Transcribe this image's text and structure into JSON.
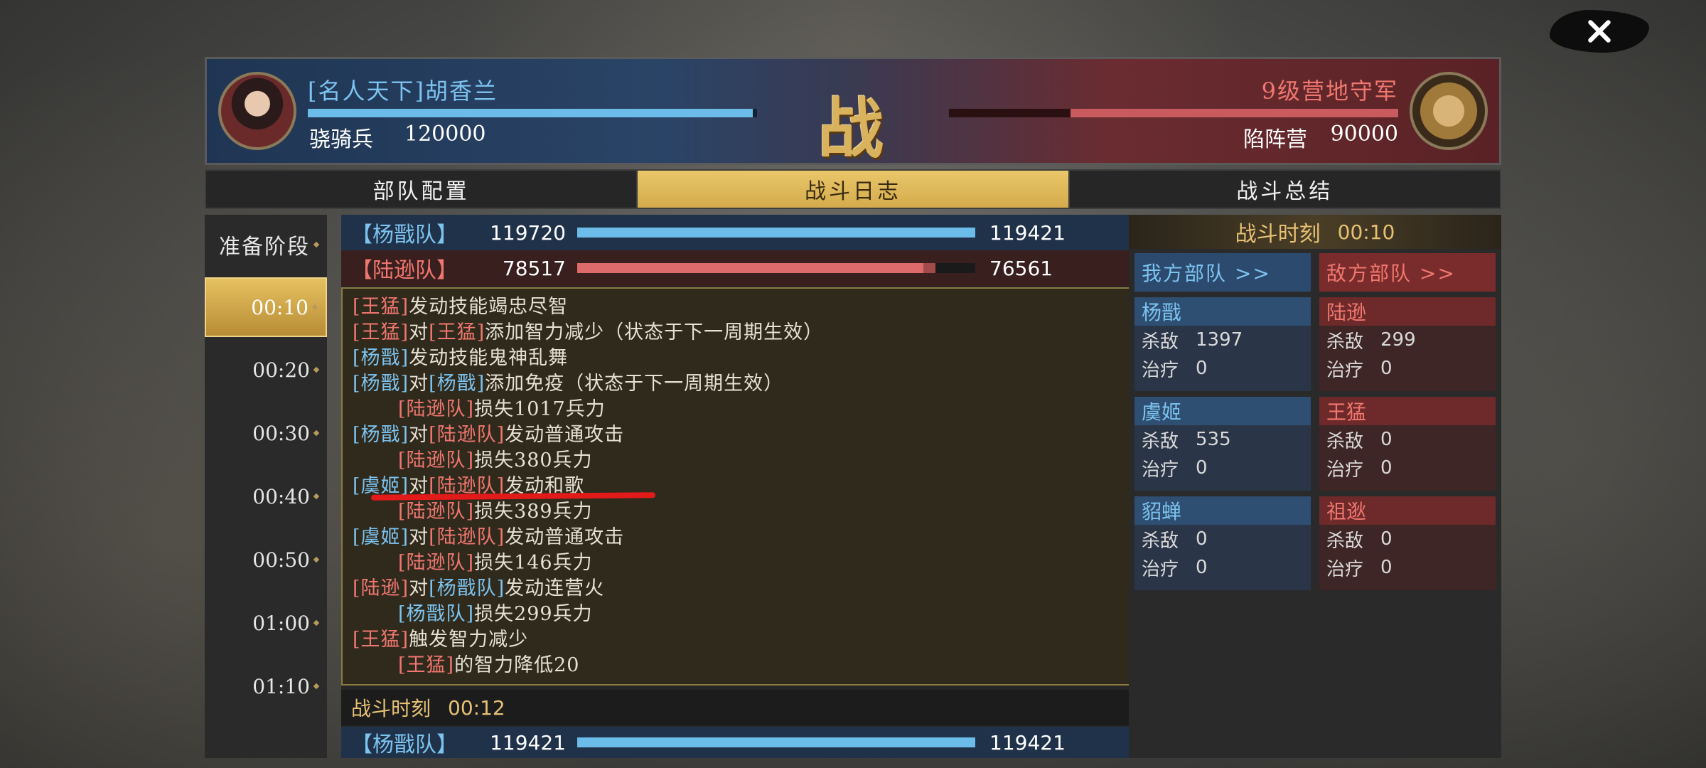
{
  "header": {
    "left_name": "[名人天下]胡香兰",
    "left_unit_type": "骁骑兵",
    "left_count": "120000",
    "left_bar_fill": 0.99,
    "battle_glyph": "战",
    "right_name": "9级营地守军",
    "right_unit_type": "陷阵营",
    "right_count": "90000",
    "right_bar_fill": 0.73
  },
  "tabs": [
    {
      "label": "部队配置",
      "active": false
    },
    {
      "label": "战斗日志",
      "active": true
    },
    {
      "label": "战斗总结",
      "active": false
    }
  ],
  "timeline": {
    "prep": "准备阶段",
    "times": [
      "00:10",
      "00:20",
      "00:30",
      "00:40",
      "00:50",
      "01:00",
      "01:10"
    ],
    "active_index": 0
  },
  "log": {
    "blue_team": {
      "name": "【杨戬队】",
      "start": "119720",
      "end": "119421",
      "fill": 1.0
    },
    "red_team": {
      "name": "【陆逊队】",
      "start": "78517",
      "end": "76561",
      "fill": 0.87,
      "loss_fill": 0.03
    },
    "lines": {
      "l1": {
        "a": "[王猛]",
        "t": "发动技能竭忠尽智"
      },
      "l2": {
        "a": "[王猛]",
        "m": "对",
        "b": "[王猛]",
        "t": "添加智力减少（状态于下一周期生效）"
      },
      "l3": {
        "a": "[杨戬]",
        "t": "发动技能鬼神乱舞"
      },
      "l4": {
        "a": "[杨戬]",
        "m": "对",
        "b": "[杨戬]",
        "t": "添加免疫（状态于下一周期生效）"
      },
      "l5": {
        "a": "[陆逊队]",
        "t": "损失1017兵力"
      },
      "l6": {
        "a": "[杨戬]",
        "m": "对",
        "b": "[陆逊队]",
        "t": "发动普通攻击"
      },
      "l7": {
        "a": "[陆逊队]",
        "t": "损失380兵力"
      },
      "l8": {
        "a": "[虞姬]",
        "m": "对",
        "b": "[陆逊队]",
        "t": "发动和歌"
      },
      "l9": {
        "a": "[陆逊队]",
        "t": "损失389兵力"
      },
      "l10": {
        "a": "[虞姬]",
        "m": "对",
        "b": "[陆逊队]",
        "t": "发动普通攻击"
      },
      "l11": {
        "a": "[陆逊队]",
        "t": "损失146兵力"
      },
      "l12": {
        "a": "[陆逊]",
        "m": "对",
        "b": "[杨戬队]",
        "t": "发动连营火"
      },
      "l13": {
        "a": "[杨戬队]",
        "t": "损失299兵力"
      },
      "l14": {
        "a": "[王猛]",
        "t": "触发智力减少"
      },
      "l15": {
        "a": "[王猛]",
        "t": "的智力降低20"
      }
    },
    "next_moment_label": "战斗时刻",
    "next_moment_time": "00:12",
    "next_blue_team": {
      "name": "【杨戬队】",
      "start": "119421",
      "end": "119421",
      "fill": 1.0
    }
  },
  "stats": {
    "title": "战斗时刻",
    "time": "00:10",
    "kill_label": "杀敌",
    "heal_label": "治疗",
    "ally_header": "我方部队 >>",
    "enemy_header": "敌方部队 >>",
    "ally": [
      {
        "name": "杨戬",
        "kill": "1397",
        "heal": "0"
      },
      {
        "name": "虞姬",
        "kill": "535",
        "heal": "0"
      },
      {
        "name": "貂蝉",
        "kill": "0",
        "heal": "0"
      }
    ],
    "enemy": [
      {
        "name": "陆逊",
        "kill": "299",
        "heal": "0"
      },
      {
        "name": "王猛",
        "kill": "0",
        "heal": "0"
      },
      {
        "name": "祖逖",
        "kill": "0",
        "heal": "0"
      }
    ]
  },
  "icons": {
    "close": "close-icon",
    "chevron": "chevron-down-icon"
  },
  "colors": {
    "ally": "#7cc3ef",
    "enemy": "#f0776f",
    "gold": "#e6c173"
  }
}
